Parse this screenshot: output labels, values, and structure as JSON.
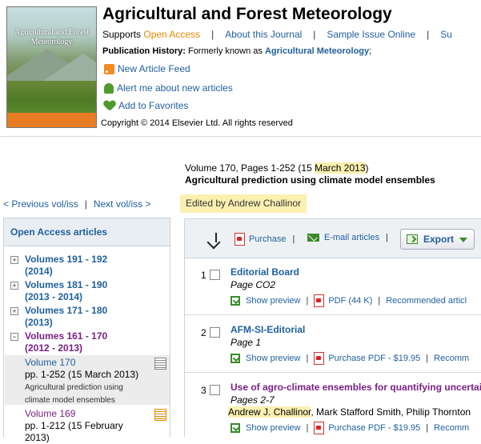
{
  "header": {
    "journal_title": "Agricultural and Forest Meteorology",
    "cover_title": "Agricultural and Forest Meteorology",
    "supports_label": "Supports",
    "open_access": "Open Access",
    "nav_links": [
      "About this Journal",
      "Sample Issue Online",
      "Su"
    ],
    "pub_history_label": "Publication History:",
    "pub_history_text": "Formerly known as",
    "pub_history_link": "Agricultural Meteorology",
    "pub_history_suffix": ";",
    "feed_link": "New Article Feed",
    "alert_link": "Alert me about new articles",
    "favorites_link": "Add to Favorites",
    "copyright": "Copyright © 2014 Elsevier Ltd. All rights reserved"
  },
  "issue": {
    "volume_prefix": "Volume 170, Pages 1-252 (15 ",
    "volume_date": "March 2013",
    "volume_suffix": ")",
    "title": "Agricultural prediction using climate model ensembles",
    "edited_by": "Edited by Andrew Challinor",
    "prev_link": "< Previous vol/iss",
    "next_link": "Next vol/iss >"
  },
  "sidebar": {
    "open_access_label": "Open Access articles",
    "volumes": [
      {
        "toggle": "+",
        "line1": "Volumes 191 - 192",
        "line2": "(2014)"
      },
      {
        "toggle": "+",
        "line1": "Volumes 181 - 190",
        "line2": "(2013 - 2014)"
      },
      {
        "toggle": "+",
        "line1": "Volumes 171 - 180",
        "line2": "(2013)"
      },
      {
        "toggle": "−",
        "line1": "Volumes 161 - 170",
        "line2": "(2012 - 2013)"
      }
    ],
    "issues": [
      {
        "name": "Volume 170",
        "pages": "pp. 1-252 (15 March 2013)",
        "sub1": "Agricultural prediction using",
        "sub2": "climate model ensembles"
      },
      {
        "name": "Volume 169",
        "pages": "pp. 1-212 (15 February",
        "sub1": "2013)"
      }
    ]
  },
  "toolbar": {
    "purchase": "Purchase",
    "email": "E-mail articles",
    "export": "Export"
  },
  "articles": [
    {
      "num": "1",
      "title": "Editorial Board",
      "page": "Page CO2",
      "preview": "Show preview",
      "pdf": "PDF (44 K)",
      "extra": "Recommended articl"
    },
    {
      "num": "2",
      "title": "AFM-SI-Editorial",
      "page": "Page 1",
      "preview": "Show preview",
      "pdf": "Purchase PDF - $19.95",
      "extra": "Recomm"
    },
    {
      "num": "3",
      "title": "Use of agro-climate ensembles for quantifying uncertai",
      "page": "Pages 2-7",
      "author_hl": "Andrew J. Challinor",
      "authors_rest": ", Mark Stafford Smith, Philip Thornton",
      "preview": "Show preview",
      "pdf": "Purchase PDF - $19.95",
      "extra": "Recomm"
    }
  ]
}
